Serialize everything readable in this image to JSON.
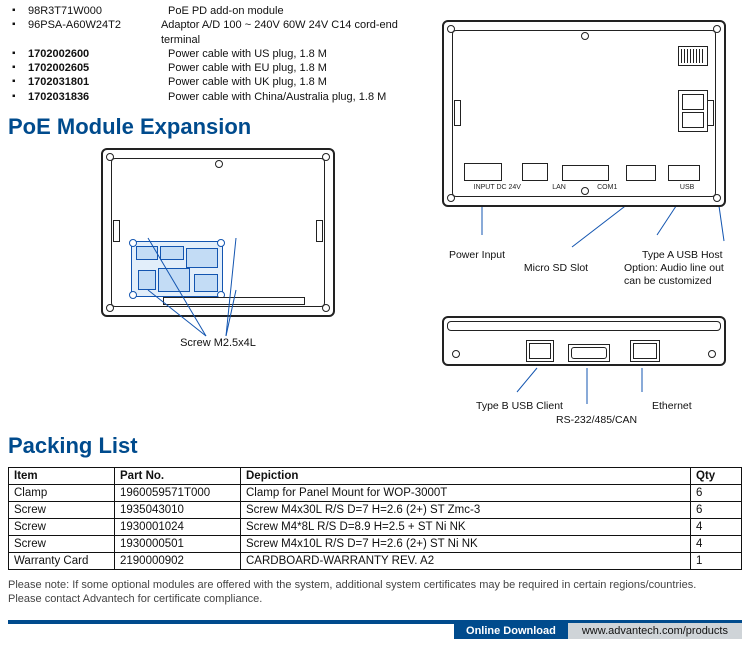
{
  "accessories": [
    {
      "sku": "98R3T71W000",
      "bold": false,
      "desc": "PoE PD add-on module"
    },
    {
      "sku": "96PSA-A60W24T2",
      "bold": false,
      "desc": "Adaptor A/D 100 ~ 240V 60W 24V C14 cord-end terminal"
    },
    {
      "sku": "1702002600",
      "bold": true,
      "desc": "Power cable with US plug, 1.8 M"
    },
    {
      "sku": "1702002605",
      "bold": true,
      "desc": "Power cable with EU plug, 1.8 M"
    },
    {
      "sku": "1702031801",
      "bold": true,
      "desc": "Power cable with UK plug, 1.8 M"
    },
    {
      "sku": "1702031836",
      "bold": true,
      "desc": "Power cable with China/Australia plug, 1.8 M"
    }
  ],
  "sections": {
    "poe_title": "PoE Module Expansion",
    "poe_caption": "Screw M2.5x4L",
    "packing_title": "Packing List"
  },
  "io_labels": {
    "power_input": "Power Input",
    "micro_sd": "Micro SD Slot",
    "usb_a": "Type A USB Host",
    "audio_opt_l1": "Option: Audio line out",
    "audio_opt_l2": "can be customized",
    "usb_b": "Type B USB Client",
    "rs": "RS-232/485/CAN",
    "ethernet": "Ethernet"
  },
  "port_strip": {
    "p1": "INPUT DC 24V",
    "p2": "LAN",
    "p3": "COM1",
    "p4": "USB"
  },
  "packing_headers": {
    "item": "Item",
    "part": "Part No.",
    "dep": "Depiction",
    "qty": "Qty"
  },
  "packing": [
    {
      "item": "Clamp",
      "part": "1960059571T000",
      "dep": "Clamp for Panel Mount for WOP-3000T",
      "qty": "6"
    },
    {
      "item": "Screw",
      "part": "1935043010",
      "dep": "Screw M4x30L R/S D=7 H=2.6 (2+) ST Zmc-3",
      "qty": "6"
    },
    {
      "item": "Screw",
      "part": "1930001024",
      "dep": "Screw M4*8L R/S D=8.9 H=2.5 + ST Ni NK",
      "qty": "4"
    },
    {
      "item": "Screw",
      "part": "1930000501",
      "dep": "Screw M4x10L R/S D=7 H=2.6 (2+) ST Ni NK",
      "qty": "4"
    },
    {
      "item": "Warranty Card",
      "part": "2190000902",
      "dep": "CARDBOARD-WARRANTY REV. A2",
      "qty": "1"
    }
  ],
  "note": {
    "l1": "Please note: If some optional modules are offered with the system, additional system certificates may be required in certain regions/countries.",
    "l2": "Please contact Advantech for certificate compliance."
  },
  "footer": {
    "label": "Online Download",
    "url": "www.advantech.com/products"
  }
}
